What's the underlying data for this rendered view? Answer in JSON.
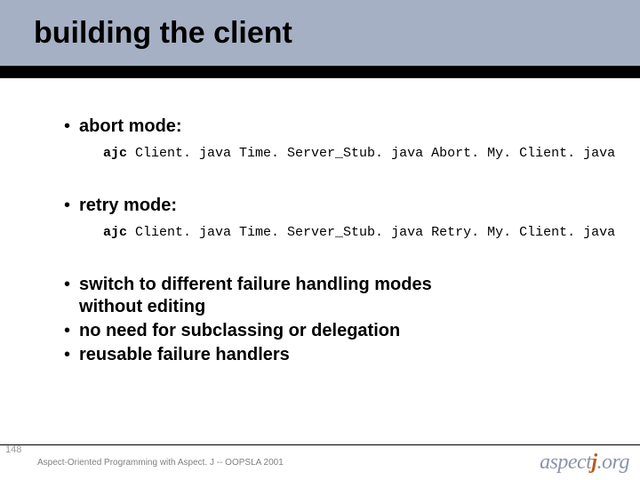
{
  "title": "building the client",
  "bullets": {
    "abort_label": "abort mode:",
    "abort_cmd_kw": "ajc",
    "abort_cmd_rest": " Client. java Time. Server_Stub. java Abort. My. Client. java",
    "retry_label": "retry mode:",
    "retry_cmd_kw": "ajc",
    "retry_cmd_rest": " Client. java Time. Server_Stub. java Retry. My. Client. java",
    "switch_line1": "switch to different failure handling modes",
    "switch_line2": "without editing",
    "no_subclass": "no need for subclassing or delegation",
    "reusable": "reusable failure handlers"
  },
  "footer": {
    "page": "148",
    "text": "Aspect-Oriented Programming with Aspect. J -- OOPSLA 2001",
    "logo_main": "aspect",
    "logo_j": "j",
    "logo_suffix": ".org"
  }
}
